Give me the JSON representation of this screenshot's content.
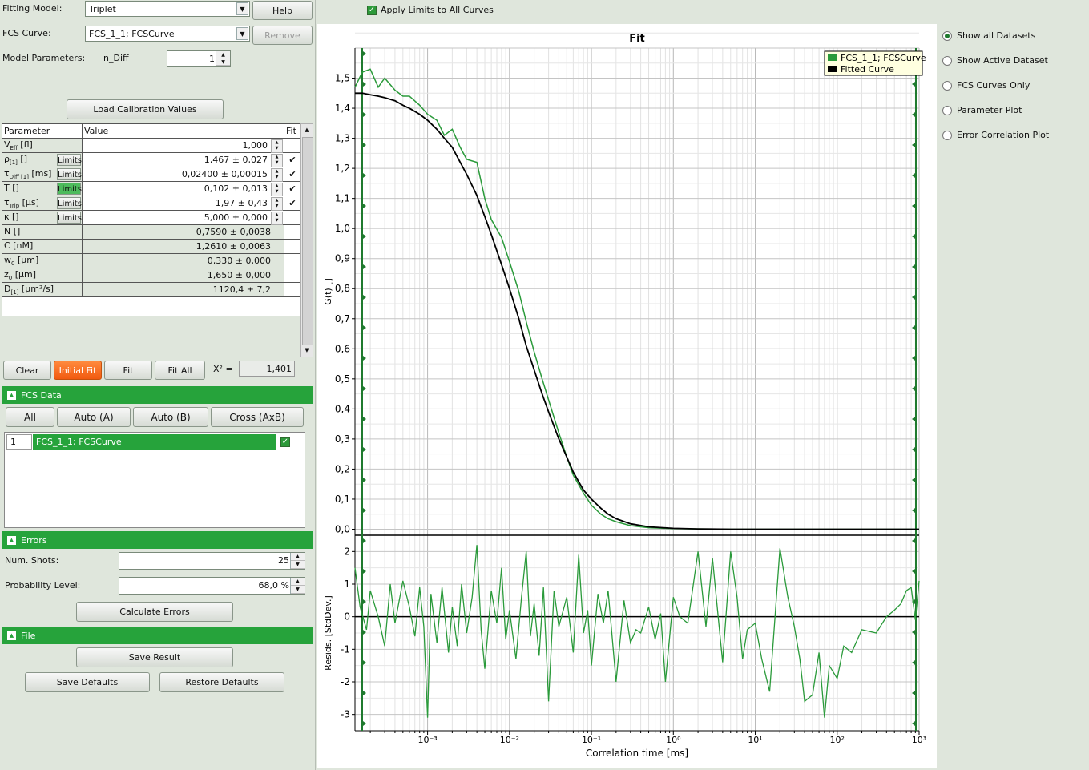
{
  "controls": {
    "fitting_model_label": "Fitting Model:",
    "fitting_model_value": "Triplet",
    "help_button": "Help",
    "fcs_curve_label": "FCS Curve:",
    "fcs_curve_value": "FCS_1_1;  FCSCurve",
    "remove_button": "Remove",
    "model_params_label": "Model Parameters:",
    "n_diff_label": "n_Diff",
    "n_diff_value": "1",
    "load_calibration_button": "Load Calibration Values",
    "apply_limits_label": "Apply Limits to All Curves"
  },
  "param_table": {
    "headers": [
      "Parameter",
      "Value",
      "Fit"
    ],
    "limits_label": "Limits",
    "rows": [
      {
        "name_main": "V",
        "name_sub": "Eff",
        "name_unit": " [fl]",
        "value": "1,000",
        "limits": false,
        "fit": false,
        "editable": true
      },
      {
        "name_main": "ρ",
        "name_sub": "[1]",
        "name_unit": " []",
        "value": "1,467  ± 0,027",
        "limits": true,
        "limits_active": false,
        "fit": true,
        "editable": true
      },
      {
        "name_main": "τ",
        "name_sub": "Diff [1]",
        "name_unit": " [ms]",
        "value": "0,02400  ± 0,00015",
        "limits": true,
        "limits_active": false,
        "fit": true,
        "editable": true
      },
      {
        "name_main": "T",
        "name_sub": "",
        "name_unit": " []",
        "value": "0,102  ± 0,013",
        "limits": true,
        "limits_active": true,
        "fit": true,
        "editable": true
      },
      {
        "name_main": "τ",
        "name_sub": "Trip",
        "name_unit": " [µs]",
        "value": "1,97  ± 0,43",
        "limits": true,
        "limits_active": false,
        "fit": true,
        "editable": true
      },
      {
        "name_main": "κ",
        "name_sub": "",
        "name_unit": " []",
        "value": "5,000  ± 0,000",
        "limits": true,
        "limits_active": false,
        "fit": false,
        "editable": true
      },
      {
        "name_main": "N",
        "name_sub": "",
        "name_unit": " []",
        "value": "0,7590  ± 0,0038",
        "limits": false,
        "fit": false,
        "editable": false
      },
      {
        "name_main": "C",
        "name_sub": "",
        "name_unit": " [nM]",
        "value": "1,2610  ± 0,0063",
        "limits": false,
        "fit": false,
        "editable": false
      },
      {
        "name_main": "w",
        "name_sub": "0",
        "name_unit": " [µm]",
        "value": "0,330  ± 0,000",
        "limits": false,
        "fit": false,
        "editable": false
      },
      {
        "name_main": "z",
        "name_sub": "0",
        "name_unit": " [µm]",
        "value": "1,650  ± 0,000",
        "limits": false,
        "fit": false,
        "editable": false
      },
      {
        "name_main": "D",
        "name_sub": "[1]",
        "name_unit": " [µm²/s]",
        "value": "1120,4  ± 7,2",
        "limits": false,
        "fit": false,
        "editable": false
      }
    ]
  },
  "fit_buttons": {
    "clear": "Clear",
    "initial_fit": "Initial Fit",
    "fit": "Fit",
    "fit_all": "Fit All",
    "chi2_label": "X² =",
    "chi2_value": "1,401"
  },
  "fcs_data": {
    "title": "FCS Data",
    "buttons": [
      "All",
      "Auto (A)",
      "Auto (B)",
      "Cross (AxB)"
    ],
    "items": [
      {
        "index": "1",
        "name": "FCS_1_1;  FCSCurve",
        "checked": true
      }
    ]
  },
  "errors": {
    "title": "Errors",
    "num_shots_label": "Num. Shots:",
    "num_shots_value": "25",
    "prob_level_label": "Probability Level:",
    "prob_level_value": "68,0 %",
    "calculate_button": "Calculate Errors"
  },
  "file": {
    "title": "File",
    "save_result": "Save Result",
    "save_defaults": "Save Defaults",
    "restore_defaults": "Restore Defaults"
  },
  "view_options": [
    {
      "label": "Show all Datasets",
      "selected": true
    },
    {
      "label": "Show Active Dataset",
      "selected": false
    },
    {
      "label": "FCS Curves Only",
      "selected": false
    },
    {
      "label": "Parameter Plot",
      "selected": false
    },
    {
      "label": "Error Correlation Plot",
      "selected": false
    }
  ],
  "colors": {
    "accent": "#26a33b",
    "data_line": "#2a9a3a",
    "fit_line": "#000000",
    "orange": "#f15a10"
  },
  "chart_data": [
    {
      "type": "line",
      "title": "Fit",
      "ylabel": "G(t) []",
      "xscale": "log",
      "xlim": [
        0.00013,
        1000
      ],
      "ylim": [
        -0.02,
        1.6
      ],
      "yticks": [
        "1,5",
        "1,4",
        "1,3",
        "1,2",
        "1,1",
        "1,0",
        "0,9",
        "0,8",
        "0,7",
        "0,6",
        "0,5",
        "0,4",
        "0,3",
        "0,2",
        "0,1",
        "0,0"
      ],
      "legend": {
        "placement": "top-right",
        "entries": [
          "FCS_1_1;  FCSCurve",
          "Fitted Curve"
        ]
      },
      "grid": true,
      "series": [
        {
          "name": "FCS_1_1;  FCSCurve",
          "color": "#2a9a3a",
          "x": [
            0.00013,
            0.00016,
            0.0002,
            0.00025,
            0.0003,
            0.0004,
            0.0005,
            0.0006,
            0.0008,
            0.001,
            0.0013,
            0.0016,
            0.002,
            0.0025,
            0.003,
            0.004,
            0.005,
            0.006,
            0.008,
            0.01,
            0.013,
            0.016,
            0.02,
            0.025,
            0.03,
            0.04,
            0.05,
            0.06,
            0.08,
            0.1,
            0.13,
            0.16,
            0.2,
            0.3,
            0.5,
            1,
            2,
            5,
            10,
            50,
            100,
            1000
          ],
          "y": [
            1.47,
            1.52,
            1.53,
            1.47,
            1.5,
            1.46,
            1.44,
            1.44,
            1.41,
            1.38,
            1.36,
            1.31,
            1.33,
            1.27,
            1.23,
            1.22,
            1.1,
            1.03,
            0.97,
            0.89,
            0.79,
            0.69,
            0.59,
            0.5,
            0.43,
            0.32,
            0.24,
            0.18,
            0.12,
            0.08,
            0.05,
            0.035,
            0.025,
            0.012,
            0.005,
            0.002,
            0.001,
            0.0,
            0.0,
            0.0,
            0.0,
            0.0
          ]
        },
        {
          "name": "Fitted Curve",
          "color": "#000000",
          "x": [
            0.00013,
            0.00016,
            0.0002,
            0.00025,
            0.0003,
            0.0004,
            0.0005,
            0.0006,
            0.0008,
            0.001,
            0.0013,
            0.0016,
            0.002,
            0.0025,
            0.003,
            0.004,
            0.005,
            0.006,
            0.008,
            0.01,
            0.013,
            0.016,
            0.02,
            0.025,
            0.03,
            0.04,
            0.05,
            0.06,
            0.08,
            0.1,
            0.13,
            0.16,
            0.2,
            0.3,
            0.5,
            1,
            2,
            5,
            10,
            50,
            100,
            1000
          ],
          "y": [
            1.45,
            1.45,
            1.445,
            1.44,
            1.435,
            1.425,
            1.41,
            1.4,
            1.38,
            1.36,
            1.33,
            1.3,
            1.27,
            1.22,
            1.18,
            1.11,
            1.04,
            0.98,
            0.88,
            0.8,
            0.7,
            0.61,
            0.53,
            0.45,
            0.39,
            0.3,
            0.24,
            0.19,
            0.13,
            0.1,
            0.07,
            0.05,
            0.035,
            0.018,
            0.008,
            0.003,
            0.001,
            0.0,
            0.0,
            0.0,
            0.0,
            0.0
          ]
        }
      ]
    },
    {
      "type": "line",
      "xlabel": "Correlation time [ms]",
      "ylabel": "Resids. [StdDev.]",
      "xscale": "log",
      "xlim": [
        0.00013,
        1000
      ],
      "ylim": [
        -3.5,
        2.5
      ],
      "yticks": [
        "2",
        "1",
        "0",
        "-1",
        "-2",
        "-3"
      ],
      "xticks": [
        "10⁻³",
        "10⁻²",
        "10⁻¹",
        "10⁰",
        "10¹",
        "10²",
        "10³"
      ],
      "grid": true,
      "series": [
        {
          "name": "FCS_1_1;  FCSCurve",
          "color": "#2a9a3a",
          "x": [
            0.00013,
            0.00015,
            0.00018,
            0.0002,
            0.00025,
            0.0003,
            0.00035,
            0.0004,
            0.0005,
            0.0006,
            0.0007,
            0.0008,
            0.0009,
            0.001,
            0.0011,
            0.0013,
            0.0015,
            0.0018,
            0.002,
            0.0023,
            0.0026,
            0.003,
            0.0035,
            0.004,
            0.0045,
            0.005,
            0.006,
            0.007,
            0.008,
            0.009,
            0.01,
            0.012,
            0.014,
            0.016,
            0.018,
            0.02,
            0.023,
            0.026,
            0.03,
            0.035,
            0.04,
            0.05,
            0.06,
            0.07,
            0.08,
            0.09,
            0.1,
            0.12,
            0.14,
            0.16,
            0.2,
            0.25,
            0.3,
            0.35,
            0.4,
            0.5,
            0.6,
            0.7,
            0.8,
            1,
            1.2,
            1.5,
            2,
            2.5,
            3,
            4,
            5,
            6,
            7,
            8,
            10,
            12,
            15,
            20,
            25,
            30,
            35,
            40,
            50,
            60,
            70,
            80,
            100,
            120,
            150,
            200,
            300,
            400,
            500,
            600,
            700,
            800,
            900,
            1000
          ],
          "y": [
            1.5,
            0.3,
            -0.4,
            0.8,
            0.0,
            -0.9,
            1.0,
            -0.2,
            1.1,
            0.3,
            -0.6,
            0.9,
            -0.3,
            -3.1,
            0.7,
            -0.8,
            0.9,
            -1.1,
            0.3,
            -0.9,
            1.0,
            -0.5,
            0.6,
            2.2,
            -0.4,
            -1.6,
            0.8,
            -0.2,
            1.5,
            -0.7,
            0.2,
            -1.3,
            0.6,
            2.0,
            -0.6,
            0.4,
            -1.2,
            0.9,
            -2.6,
            0.8,
            -0.3,
            0.6,
            -1.1,
            1.9,
            -0.5,
            0.2,
            -1.5,
            0.7,
            -0.2,
            0.8,
            -2.0,
            0.5,
            -0.8,
            -0.4,
            -0.5,
            0.3,
            -0.7,
            0.1,
            -2.0,
            0.6,
            0.0,
            -0.2,
            2.0,
            -0.3,
            1.8,
            -1.4,
            2.0,
            0.6,
            -1.3,
            -0.4,
            -0.2,
            -1.3,
            -2.3,
            2.1,
            0.6,
            -0.3,
            -1.3,
            -2.6,
            -2.4,
            -1.1,
            -3.1,
            -1.5,
            -1.9,
            -0.9,
            -1.1,
            -0.4,
            -0.5,
            0.0,
            0.2,
            0.4,
            0.8,
            0.9,
            -0.1,
            1.1
          ]
        }
      ]
    }
  ]
}
